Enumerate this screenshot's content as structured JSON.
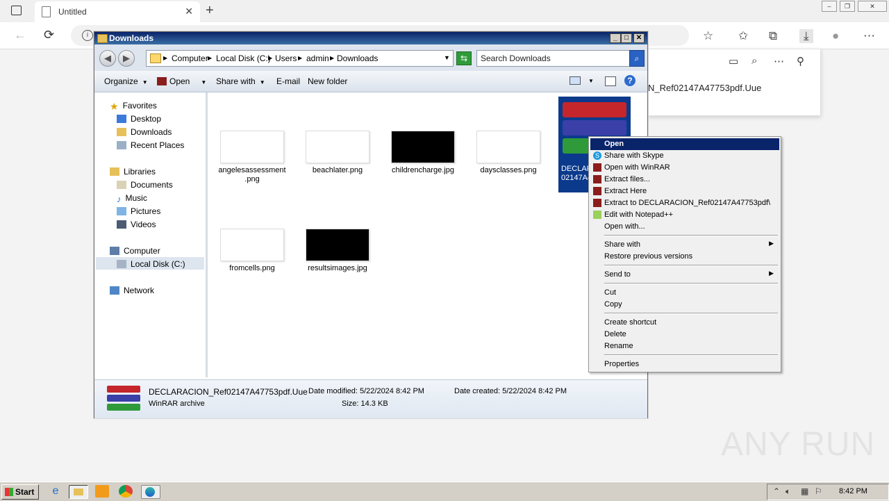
{
  "browser": {
    "tab_title": "Untitled",
    "tab_close": "✕",
    "new_tab": "+",
    "window_controls": [
      "–",
      "❐",
      "✕"
    ],
    "download_panel": {
      "file_name": "N_Ref02147A47753pdf.Uue"
    }
  },
  "explorer": {
    "title": "Downloads",
    "title_buttons": [
      "_",
      "□",
      "✕"
    ],
    "breadcrumb": [
      "Computer",
      "Local Disk (C:)",
      "Users",
      "admin",
      "Downloads"
    ],
    "search_placeholder": "Search Downloads",
    "toolbar": {
      "organize": "Organize",
      "open": "Open",
      "share_with": "Share with",
      "email": "E-mail",
      "new_folder": "New folder"
    },
    "nav": {
      "favorites": "Favorites",
      "desktop": "Desktop",
      "downloads": "Downloads",
      "recent_places": "Recent Places",
      "libraries": "Libraries",
      "documents": "Documents",
      "music": "Music",
      "pictures": "Pictures",
      "videos": "Videos",
      "computer": "Computer",
      "local_disk": "Local Disk (C:)",
      "network": "Network"
    },
    "files": {
      "f1": "angelesassessment\n.png",
      "f2": "beachlater.png",
      "f3": "childrencharge.jpg",
      "f4": "daysclasses.png",
      "f5": "fromcells.png",
      "f6": "resultsimages.jpg",
      "selected_line1": "DECLAR",
      "selected_line2": "02147A4"
    },
    "details": {
      "name": "DECLARACION_Ref02147A47753pdf.Uue",
      "type": "WinRAR archive",
      "date_modified": "Date modified: 5/22/2024 8:42 PM",
      "size": "Size: 14.3 KB",
      "date_created": "Date created: 5/22/2024 8:42 PM"
    }
  },
  "context_menu": {
    "open": "Open",
    "share_skype": "Share with Skype",
    "open_winrar": "Open with WinRAR",
    "extract_files": "Extract files...",
    "extract_here": "Extract Here",
    "extract_to": "Extract to DECLARACION_Ref02147A47753pdf\\",
    "edit_notepad": "Edit with Notepad++",
    "open_with": "Open with...",
    "share_with": "Share with",
    "restore": "Restore previous versions",
    "send_to": "Send to",
    "cut": "Cut",
    "copy": "Copy",
    "create_shortcut": "Create shortcut",
    "delete": "Delete",
    "rename": "Rename",
    "properties": "Properties",
    "submenu_arrow": "▶"
  },
  "taskbar": {
    "start": "Start",
    "clock": "8:42 PM"
  },
  "watermark": "ANY RUN"
}
